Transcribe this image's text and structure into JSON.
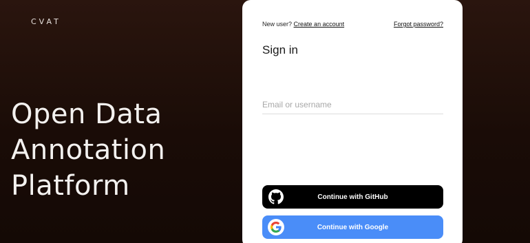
{
  "brand": {
    "logo_text": "CVAT"
  },
  "hero": {
    "lines": [
      "Open Data",
      "Annotation",
      "Platform"
    ]
  },
  "signin": {
    "new_user_text": "New user?",
    "create_account": "Create an account",
    "forgot_password": "Forgot password?",
    "title": "Sign in",
    "email_placeholder": "Email or username",
    "github_label": "Continue with GitHub",
    "google_label": "Continue with Google"
  },
  "colors": {
    "background": "#1f0f09",
    "github_button": "#000000",
    "google_button": "#4a8df8"
  },
  "icons": {
    "github": "github-icon",
    "google": "google-icon"
  }
}
